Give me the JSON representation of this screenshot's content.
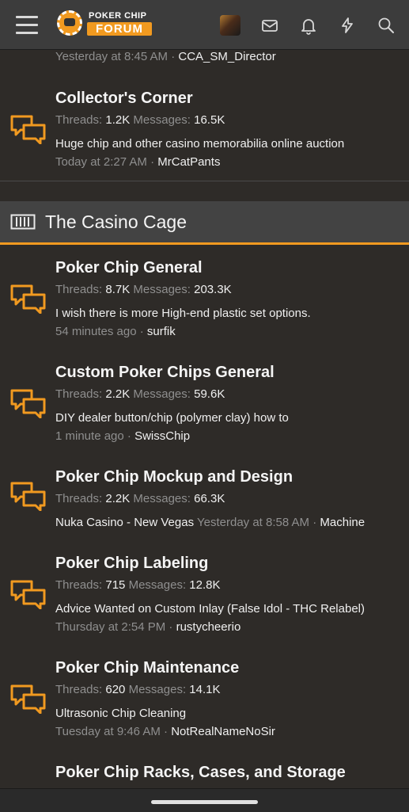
{
  "header": {
    "logo_top": "POKER CHIP",
    "logo_bottom": "FORUM"
  },
  "prev_node": {
    "time": "Yesterday at 8:45 AM",
    "sep": " · ",
    "user": "CCA_SM_Director"
  },
  "collectors_corner": {
    "title": "Collector's Corner",
    "threads_label": "Threads:",
    "threads": "1.2K",
    "messages_label": "Messages:",
    "messages": "16.5K",
    "last_title": "Huge chip and other casino memorabilia online auction",
    "last_time": "Today at 2:27 AM",
    "last_user": "MrCatPants"
  },
  "category": {
    "title": "The Casino Cage"
  },
  "nodes": [
    {
      "title": "Poker Chip General",
      "threads_label": "Threads:",
      "threads": "8.7K",
      "messages_label": "Messages:",
      "messages": "203.3K",
      "last_title": "I wish there is more High-end plastic set options.",
      "last_time": "54 minutes ago",
      "last_user": "surfik"
    },
    {
      "title": "Custom Poker Chips General",
      "threads_label": "Threads:",
      "threads": "2.2K",
      "messages_label": "Messages:",
      "messages": "59.6K",
      "last_title": "DIY dealer button/chip (polymer clay) how to",
      "last_time": "1 minute ago",
      "last_user": "SwissChip"
    },
    {
      "title": "Poker Chip Mockup and Design",
      "threads_label": "Threads:",
      "threads": "2.2K",
      "messages_label": "Messages:",
      "messages": "66.3K",
      "last_title": "Nuka Casino - New Vegas",
      "last_time": "Yesterday at 8:58 AM",
      "last_user": "Machine"
    },
    {
      "title": "Poker Chip Labeling",
      "threads_label": "Threads:",
      "threads": "715",
      "messages_label": "Messages:",
      "messages": "12.8K",
      "last_title": "Advice Wanted on Custom Inlay (False Idol - THC Relabel)",
      "last_time": "Thursday at 2:54 PM",
      "last_user": "rustycheerio"
    },
    {
      "title": "Poker Chip Maintenance",
      "threads_label": "Threads:",
      "threads": "620",
      "messages_label": "Messages:",
      "messages": "14.1K",
      "last_title": "Ultrasonic Chip Cleaning",
      "last_time": "Tuesday at 9:46 AM",
      "last_user": "NotRealNameNoSir"
    },
    {
      "title": "Poker Chip Racks, Cases, and Storage"
    }
  ],
  "icons": {
    "menu": "hamburger-icon",
    "inbox": "envelope-icon",
    "alerts": "bell-icon",
    "whats_new": "bolt-icon",
    "search": "search-icon",
    "forum": "speech-bubbles-icon",
    "category": "rack-icon"
  },
  "colors": {
    "accent": "#f19a20",
    "background": "#2e2b28",
    "topbar": "#3c3c3c",
    "muted_text": "#8f8f8f"
  }
}
